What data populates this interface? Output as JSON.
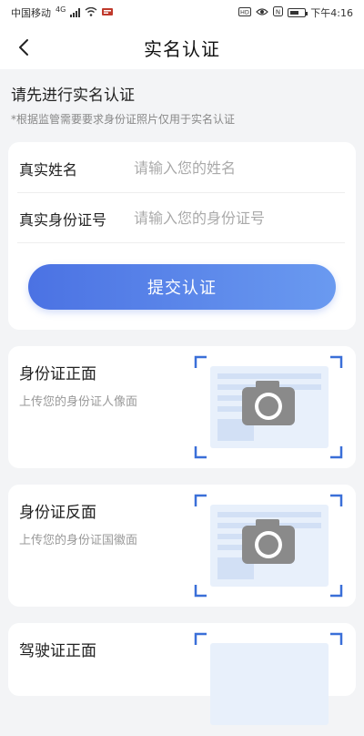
{
  "status_bar": {
    "carrier": "中国移动",
    "network": "4G",
    "right_icons": [
      "hd-icon",
      "eye-icon",
      "nfc-icon",
      "battery-icon"
    ],
    "time": "下午4:16"
  },
  "nav": {
    "title": "实名认证"
  },
  "intro": {
    "title": "请先进行实名认证",
    "subtitle": "*根据监管需要要求身份证照片仅用于实名认证"
  },
  "form": {
    "name_label": "真实姓名",
    "name_placeholder": "请输入您的姓名",
    "id_label": "真实身份证号",
    "id_placeholder": "请输入您的身份证号",
    "submit_label": "提交认证"
  },
  "uploads": [
    {
      "title": "身份证正面",
      "subtitle": "上传您的身份证人像面"
    },
    {
      "title": "身份证反面",
      "subtitle": "上传您的身份证国徽面"
    },
    {
      "title": "驾驶证正面",
      "subtitle": ""
    }
  ],
  "colors": {
    "accent_start": "#4b72e3",
    "accent_end": "#6a9af0",
    "frame_blue": "#3a6fd8",
    "camera_gray": "#8a8a8a",
    "card_tint": "#e8f0fb"
  }
}
